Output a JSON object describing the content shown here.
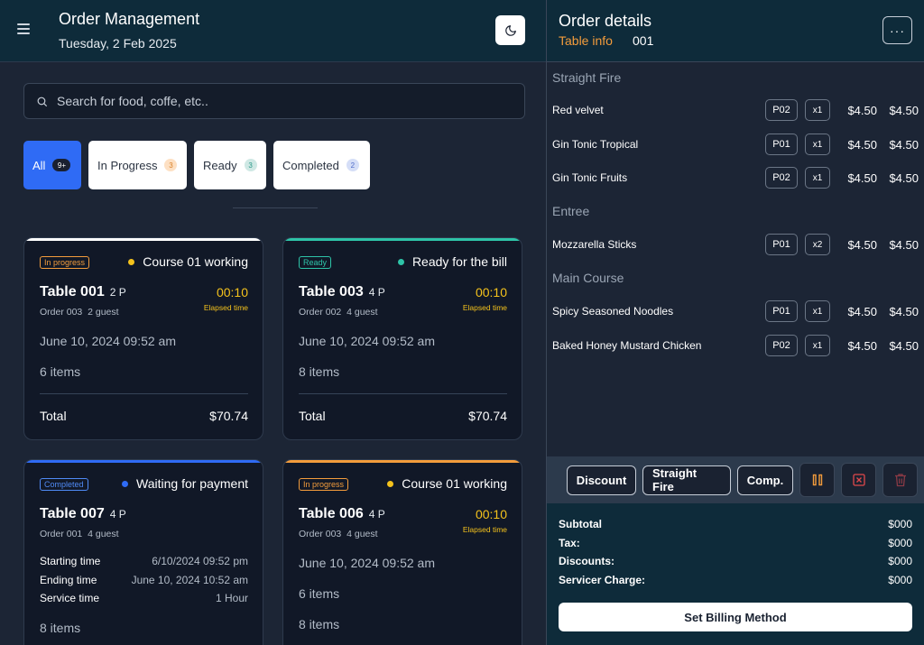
{
  "header": {
    "title": "Order Management",
    "date": "Tuesday, 2 Feb 2025",
    "menu_icon": "hamburger-icon",
    "theme_icon": "moon-icon"
  },
  "search": {
    "placeholder": "Search for food, coffe, etc.."
  },
  "filters": [
    {
      "label": "All",
      "count": "9+"
    },
    {
      "label": "In Progress",
      "count": "3"
    },
    {
      "label": "Ready",
      "count": "3"
    },
    {
      "label": "Completed",
      "count": "2"
    }
  ],
  "orders": [
    {
      "status_pill": "In progress",
      "status": "Course 01 working",
      "status_color": "#f4c21c",
      "accent": "#ffffff",
      "table": "Table 001",
      "pax": "2 P",
      "order_no": "Order 003",
      "guests": "2 guest",
      "elapsed": "00:10",
      "elapsed_label": "Elapsed time",
      "date": "June 10, 2024 09:52 am",
      "items": "6 items",
      "total_label": "Total",
      "total": "$70.74"
    },
    {
      "status_pill": "Ready",
      "status": "Ready for the bill",
      "status_color": "#2ec4a8",
      "accent": "#2ec4a8",
      "table": "Table 003",
      "pax": "4 P",
      "order_no": "Order 002",
      "guests": "4 guest",
      "elapsed": "00:10",
      "elapsed_label": "Elapsed time",
      "date": "June 10, 2024 09:52 am",
      "items": "8 items",
      "total_label": "Total",
      "total": "$70.74"
    },
    {
      "status_pill": "Completed",
      "status": "Waiting for payment",
      "status_color": "#2f6bf5",
      "accent": "#2f6bf5",
      "table": "Table 007",
      "pax": "4 P",
      "order_no": "Order 001",
      "guests": "4 guest",
      "starting_label": "Starting time",
      "starting": "6/10/2024 09:52 pm",
      "ending_label": "Ending time",
      "ending": "June 10, 2024 10:52 am",
      "service_label": "Service time",
      "service": "1 Hour",
      "items": "8 items"
    },
    {
      "status_pill": "In progress",
      "status": "Course 01 working",
      "status_color": "#f4c21c",
      "accent": "#f39c3c",
      "table": "Table 006",
      "pax": "4 P",
      "order_no": "Order 003",
      "guests": "4 guest",
      "elapsed": "00:10",
      "elapsed_label": "Elapsed time",
      "date": "June 10, 2024 09:52 am",
      "items": "6 items",
      "items2": "8 items"
    }
  ],
  "details": {
    "title": "Order details",
    "table_info_label": "Table info",
    "table_info_value": "001",
    "sections": [
      {
        "name": "Straight Fire",
        "items": [
          {
            "name": "Red velvet",
            "seat": "P02",
            "qty": "x1",
            "price": "$4.50",
            "total": "$4.50"
          },
          {
            "name": "Gin Tonic Tropical",
            "seat": "P01",
            "qty": "x1",
            "price": "$4.50",
            "total": "$4.50"
          },
          {
            "name": "Gin Tonic Fruits",
            "seat": "P02",
            "qty": "x1",
            "price": "$4.50",
            "total": "$4.50"
          }
        ]
      },
      {
        "name": "Entree",
        "items": [
          {
            "name": "Mozzarella Sticks",
            "seat": "P01",
            "qty": "x2",
            "price": "$4.50",
            "total": "$4.50"
          }
        ]
      },
      {
        "name": "Main Course",
        "items": [
          {
            "name": "Spicy Seasoned Noodles",
            "seat": "P01",
            "qty": "x1",
            "price": "$4.50",
            "total": "$4.50"
          },
          {
            "name": "Baked Honey Mustard Chicken",
            "seat": "P02",
            "qty": "x1",
            "price": "$4.50",
            "total": "$4.50"
          }
        ]
      }
    ],
    "actions": {
      "discount": "Discount",
      "straight_fire": "Straight Fire",
      "comp": "Comp."
    },
    "summary": {
      "subtotal_label": "Subtotal",
      "subtotal": "$000",
      "tax_label": "Tax:",
      "tax": "$000",
      "discounts_label": "Discounts:",
      "discounts": "$000",
      "service_label": "Servicer Charge:",
      "service": "$000"
    },
    "billing_button": "Set Billing Method"
  }
}
